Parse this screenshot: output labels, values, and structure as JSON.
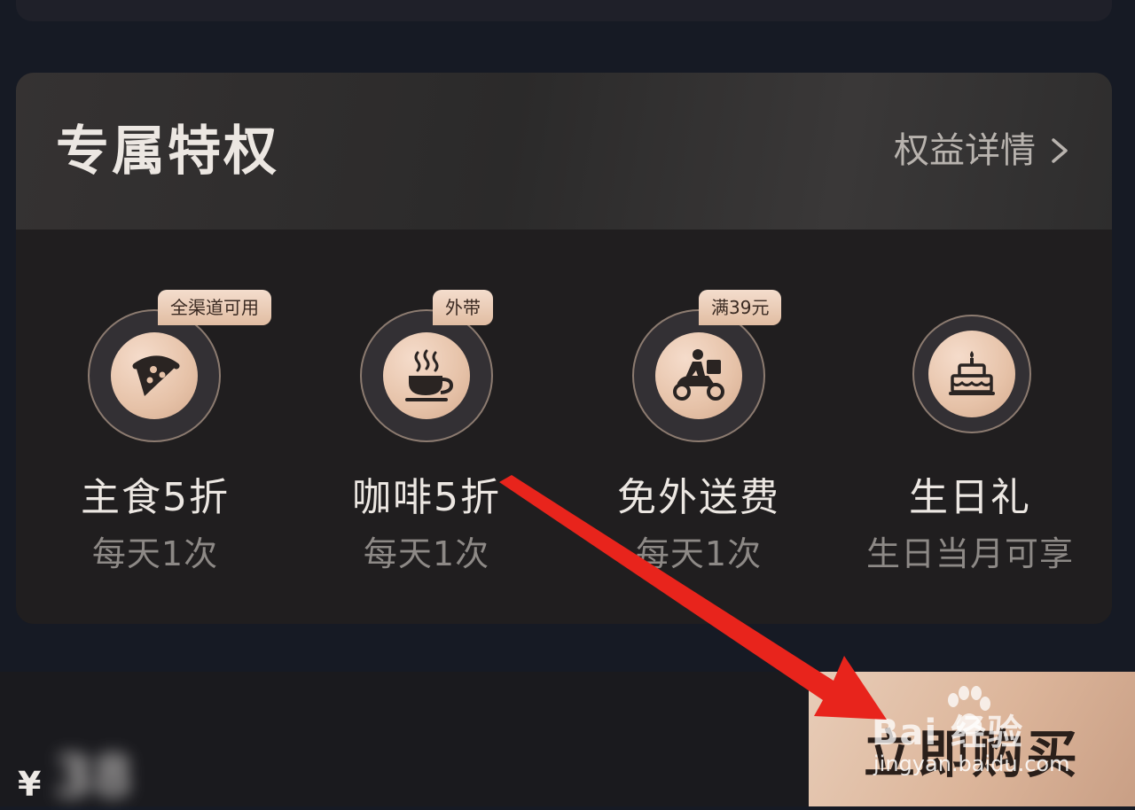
{
  "section": {
    "title": "专属特权",
    "details_link": "权益详情"
  },
  "perks": [
    {
      "badge": "全渠道可用",
      "name": "主食5折",
      "sub": "每天1次",
      "icon": "pizza-icon"
    },
    {
      "badge": "外带",
      "name": "咖啡5折",
      "sub": "每天1次",
      "icon": "coffee-cup-icon"
    },
    {
      "badge": "满39元",
      "name": "免外送费",
      "sub": "每天1次",
      "icon": "delivery-scooter-icon"
    },
    {
      "badge": "",
      "name": "生日礼",
      "sub": "生日当月可享",
      "icon": "birthday-cake-icon"
    }
  ],
  "purchase": {
    "currency": "¥",
    "amount": "38",
    "buy_label": "立即购买"
  },
  "watermark": {
    "text": "Bai 经验",
    "url": "jingyan.baidu.com"
  },
  "colors": {
    "background": "#161a24",
    "card": "#201e1f",
    "accent_gold": "#e6c2a8",
    "arrow": "#e8241c"
  }
}
